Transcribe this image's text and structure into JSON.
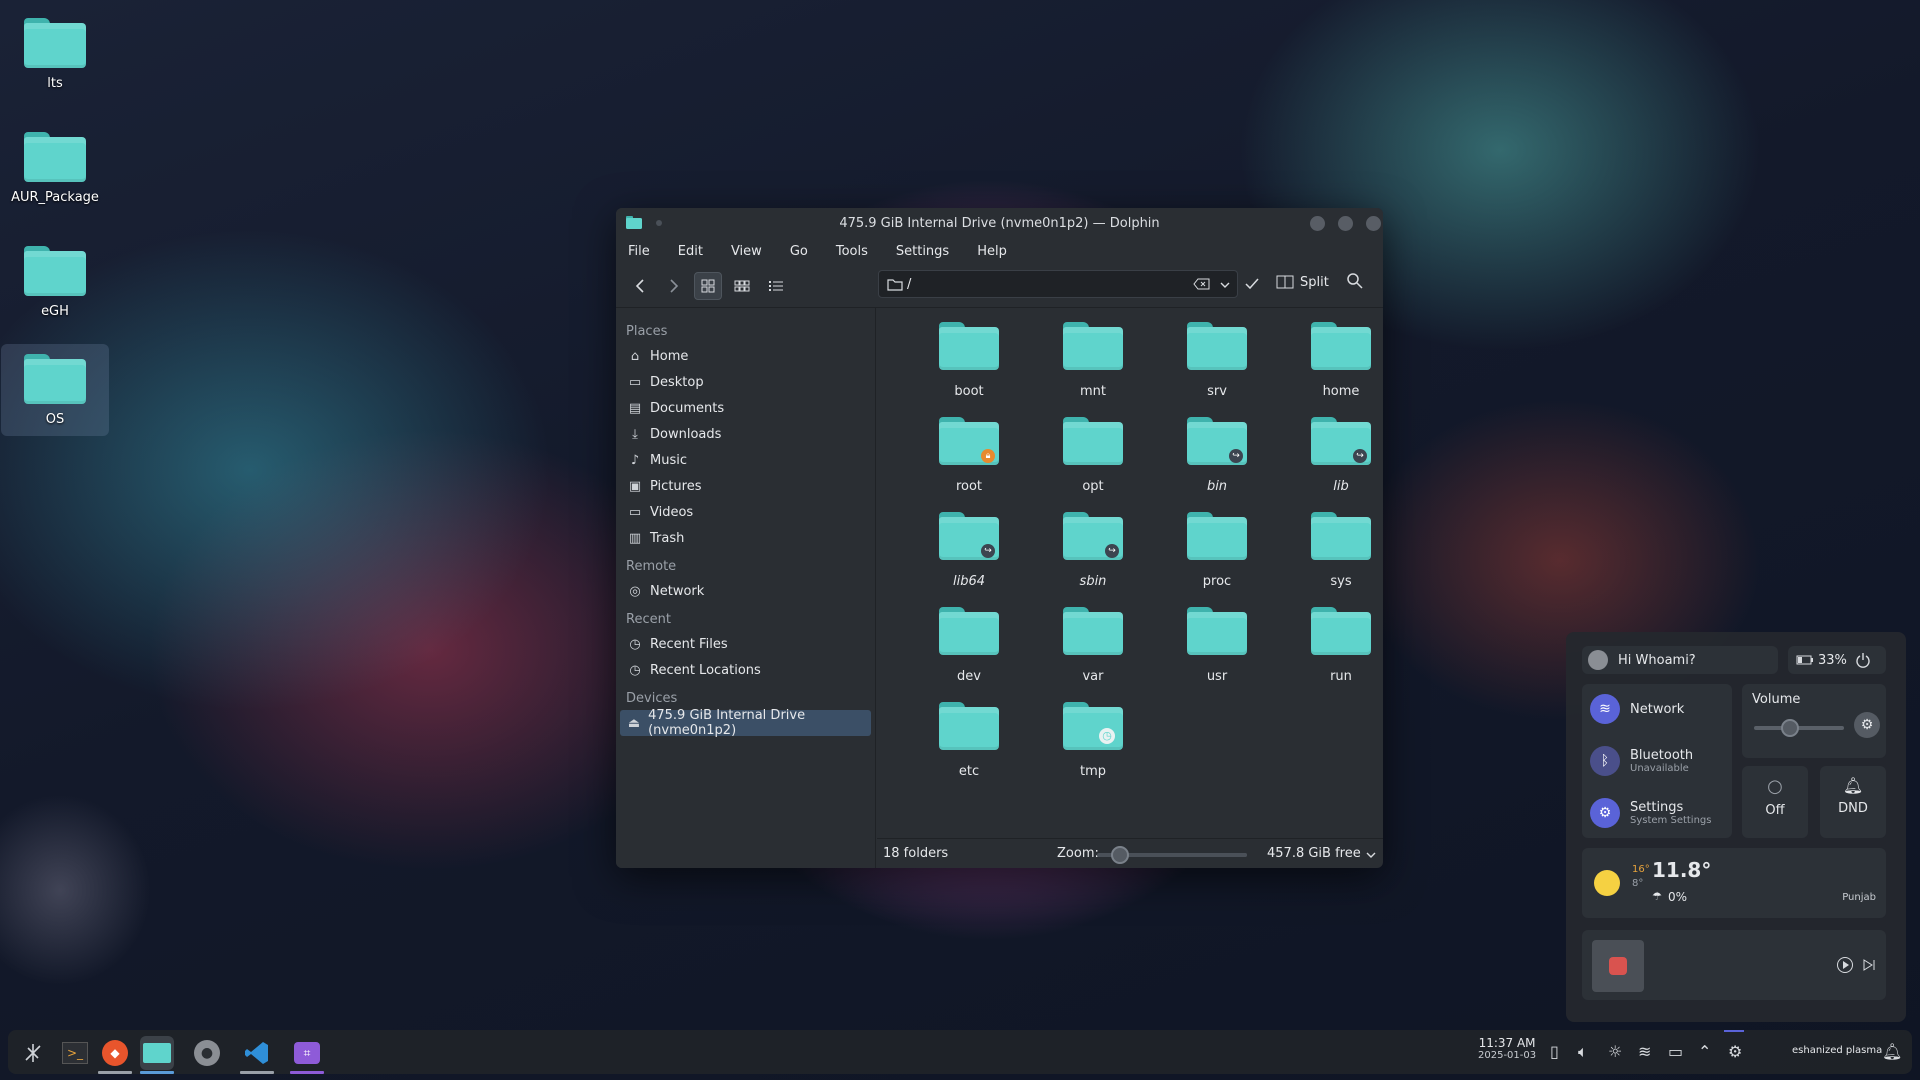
{
  "desktop": {
    "icons": [
      {
        "label": "lts"
      },
      {
        "label": "AUR_Package"
      },
      {
        "label": "eGH"
      },
      {
        "label": "OS"
      }
    ]
  },
  "window": {
    "title": "475.9 GiB Internal Drive (nvme0n1p2) — Dolphin",
    "menu": [
      "File",
      "Edit",
      "View",
      "Go",
      "Tools",
      "Settings",
      "Help"
    ],
    "path": "/",
    "split_label": "Split",
    "sidebar": {
      "places_header": "Places",
      "places": [
        "Home",
        "Desktop",
        "Documents",
        "Downloads",
        "Music",
        "Pictures",
        "Videos",
        "Trash"
      ],
      "remote_header": "Remote",
      "remote": [
        "Network"
      ],
      "recent_header": "Recent",
      "recent": [
        "Recent Files",
        "Recent Locations"
      ],
      "devices_header": "Devices",
      "devices": [
        "475.9 GiB Internal Drive (nvme0n1p2)"
      ]
    },
    "folders": [
      {
        "name": "boot"
      },
      {
        "name": "mnt"
      },
      {
        "name": "srv"
      },
      {
        "name": "home"
      },
      {
        "name": "root"
      },
      {
        "name": "opt"
      },
      {
        "name": "bin"
      },
      {
        "name": "lib"
      },
      {
        "name": "lib64"
      },
      {
        "name": "sbin"
      },
      {
        "name": "proc"
      },
      {
        "name": "sys"
      },
      {
        "name": "dev"
      },
      {
        "name": "var"
      },
      {
        "name": "usr"
      },
      {
        "name": "run"
      },
      {
        "name": "etc"
      },
      {
        "name": "tmp"
      }
    ],
    "status": {
      "count": "18 folders",
      "zoom_label": "Zoom:",
      "zoom_level": 0.15,
      "free": "457.8 GiB free"
    }
  },
  "panel": {
    "greeting": "Hi Whoami?",
    "battery": "33%",
    "network_label": "Network",
    "bluetooth_label": "Bluetooth",
    "bluetooth_sub": "Unavailable",
    "settings_label": "Settings",
    "settings_sub": "System Settings",
    "volume_label": "Volume",
    "volume_level": 0.4,
    "light_label": "Off",
    "dnd_label": "DND",
    "weather": {
      "high": "16°",
      "low": "8°",
      "current": "11.8°",
      "precip": "0%",
      "location": "Punjab"
    }
  },
  "taskbar": {
    "time": "11:37 AM",
    "date": "2025-01-03",
    "user": "eshanized plasma"
  },
  "colors": {
    "folder": "#5fd4cc",
    "accent": "#3b4f66"
  }
}
